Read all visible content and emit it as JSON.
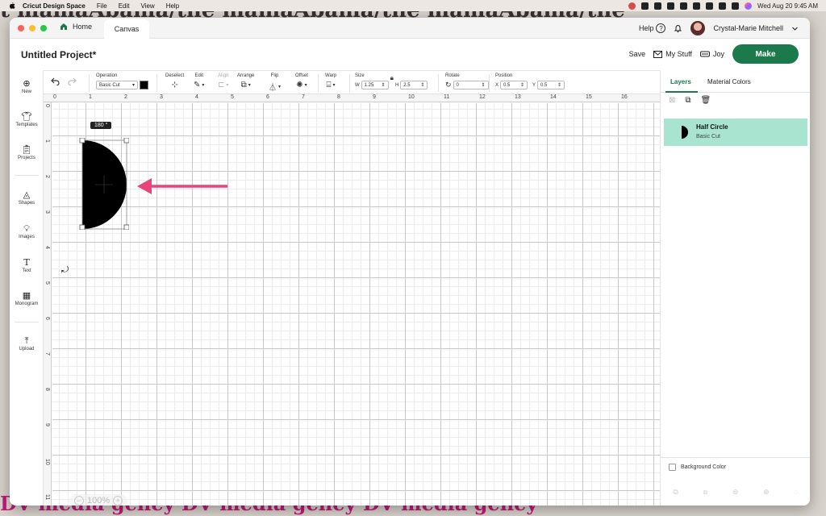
{
  "menubar": {
    "app_name": "Cricut Design Space",
    "items": [
      "File",
      "Edit",
      "View",
      "Help"
    ],
    "datetime": "Wed Aug 20  9:45 AM"
  },
  "wallpaper": {
    "top_text": "t   mamaAbama/the    mamaAbama/the    mamaAbama/the",
    "bottom_text": "DV media   geney   DV media   geney   DV media   geney"
  },
  "titlebar": {
    "home_tab": "Home",
    "canvas_tab": "Canvas",
    "help_label": "Help",
    "user_name": "Crystal-Marie Mitchell"
  },
  "project": {
    "title": "Untitled Project*",
    "save_label": "Save",
    "mystuff_label": "My Stuff",
    "joy_label": "Joy",
    "make_label": "Make"
  },
  "toolbar": {
    "operation_label": "Operation",
    "operation_value": "Basic Cut",
    "deselect_label": "Deselect",
    "edit_label": "Edit",
    "align_label": "Align",
    "arrange_label": "Arrange",
    "flip_label": "Flip",
    "offset_label": "Offset",
    "warp_label": "Warp",
    "size_label": "Size",
    "w_label": "W",
    "w_value": "1.25",
    "h_label": "H",
    "h_value": "2.5",
    "rotate_label": "Rotate",
    "rotate_value": "0",
    "position_label": "Position",
    "x_label": "X",
    "x_value": "0.5",
    "y_label": "Y",
    "y_value": "0.5",
    "swatch_color": "#000000"
  },
  "sidebar": {
    "items": [
      {
        "label": "New",
        "icon": "plus-circle-icon"
      },
      {
        "label": "Templates",
        "icon": "shirt-icon"
      },
      {
        "label": "Projects",
        "icon": "clipboard-icon"
      },
      {
        "label": "Shapes",
        "icon": "shapes-icon"
      },
      {
        "label": "Images",
        "icon": "lightbulb-icon"
      },
      {
        "label": "Text",
        "icon": "text-icon"
      },
      {
        "label": "Monogram",
        "icon": "monogram-icon"
      },
      {
        "label": "Upload",
        "icon": "upload-icon"
      }
    ]
  },
  "canvas": {
    "ruler_top": [
      "0",
      "1",
      "2",
      "3",
      "4",
      "5",
      "6",
      "7",
      "8",
      "9",
      "10",
      "11",
      "12",
      "13",
      "14",
      "15",
      "16"
    ],
    "ruler_left": [
      "0",
      "1",
      "2",
      "3",
      "4",
      "5",
      "6",
      "7",
      "8",
      "9",
      "10",
      "11"
    ],
    "rotation_badge": "180 °",
    "zoom_value": "100%",
    "arrow_color": "#e8457a"
  },
  "panel": {
    "tab_layers": "Layers",
    "tab_material": "Material Colors",
    "layer_name": "Half Circle",
    "layer_operation": "Basic Cut",
    "background_color_label": "Background Color",
    "accent_color": "#1a7a4c",
    "layer_highlight": "#a8e4cf"
  }
}
